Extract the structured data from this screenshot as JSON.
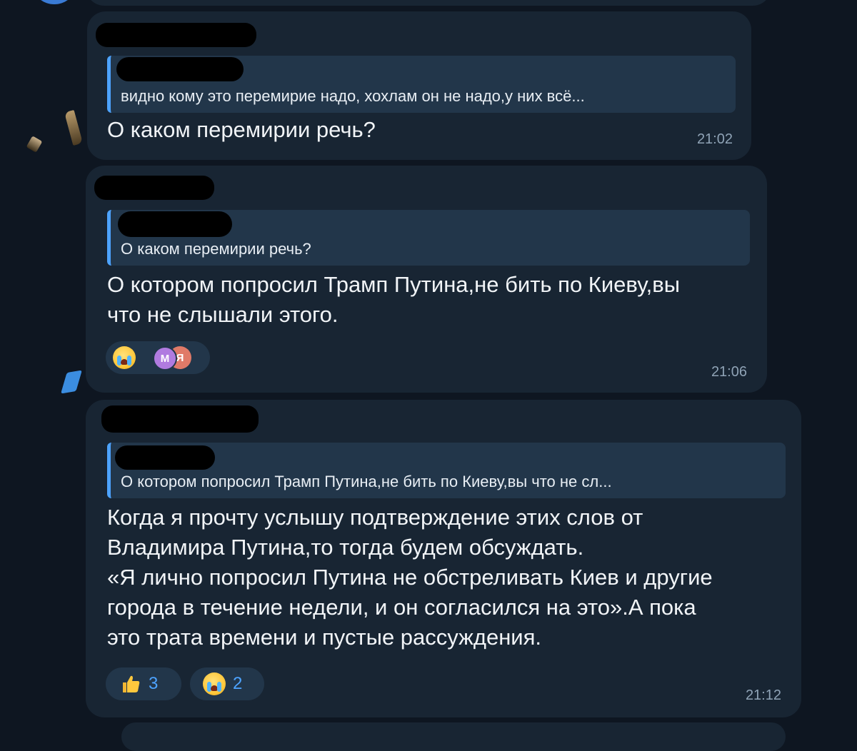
{
  "messages": [
    {
      "quote_text": "видно кому это перемирие надо, хохлам он не надо,у них всё...",
      "text": "О каком перемирии речь?",
      "time": "21:02"
    },
    {
      "quote_text": "О каком перемирии речь?",
      "text": "О котором попросил Трамп Путина,не бить по Киеву,вы\nчто не слышали этого.",
      "time": "21:06",
      "reaction_avatars": [
        "М",
        "Я"
      ],
      "reaction_emoji": "crying-face-icon"
    },
    {
      "quote_text": "О котором попросил Трамп Путина,не бить по Киеву,вы что не сл...",
      "text": "Когда я прочту услышу подтверждение этих слов от\nВладимира Путина,то тогда будем обсуждать.\n«Я лично попросил Путина не обстреливать Киев и другие\nгорода в течение недели, и он согласился на это».А пока\nэто трата времени и пустые рассуждения.",
      "time": "21:12",
      "reactions": [
        {
          "emoji": "thumbs-up-icon",
          "count": "3"
        },
        {
          "emoji": "crying-face-icon",
          "count": "2"
        }
      ]
    }
  ],
  "colors": {
    "background": "#0e1621",
    "bubble": "#182533",
    "quote_bg": "#22364a",
    "accent": "#4da3ff"
  }
}
